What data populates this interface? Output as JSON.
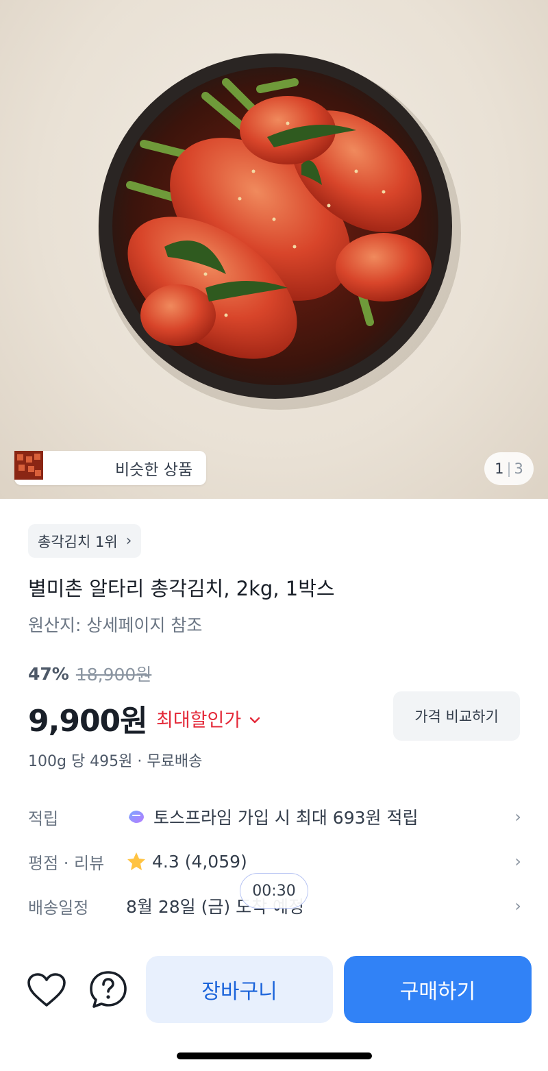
{
  "hero": {
    "similar_products_label": "비슷한 상품",
    "pager_current": "1",
    "pager_separator": "|",
    "pager_total": "3"
  },
  "product": {
    "rank_badge": "총각김치 1위",
    "title": "별미촌 알타리 총각김치, 2kg, 1박스",
    "origin": "원산지: 상세페이지 참조",
    "discount_rate": "47%",
    "original_price": "18,900원",
    "price": "9,900원",
    "best_price_label": "최대할인가",
    "compare_button_label": "가격 비교하기",
    "unit_price_info": "100g 당 495원 · 무료배송"
  },
  "info_rows": [
    {
      "label": "적립",
      "value": "토스프라임 가입 시 최대 693원 적립",
      "icon": "toss-prime-icon"
    },
    {
      "label": "평점 · 리뷰",
      "value": "4.3 (4,059)",
      "icon": "star-icon"
    },
    {
      "label": "배송일정",
      "value": "8월 28일 (금) 도착 예정"
    }
  ],
  "timer": "00:30",
  "bottom_bar": {
    "cart_label": "장바구니",
    "buy_label": "구매하기"
  },
  "colors": {
    "accent_blue": "#3182f6",
    "cart_text_blue": "#1b64da",
    "discount_red": "#e42939",
    "chip_gray": "#f2f4f6",
    "star_yellow": "#ffc342"
  }
}
